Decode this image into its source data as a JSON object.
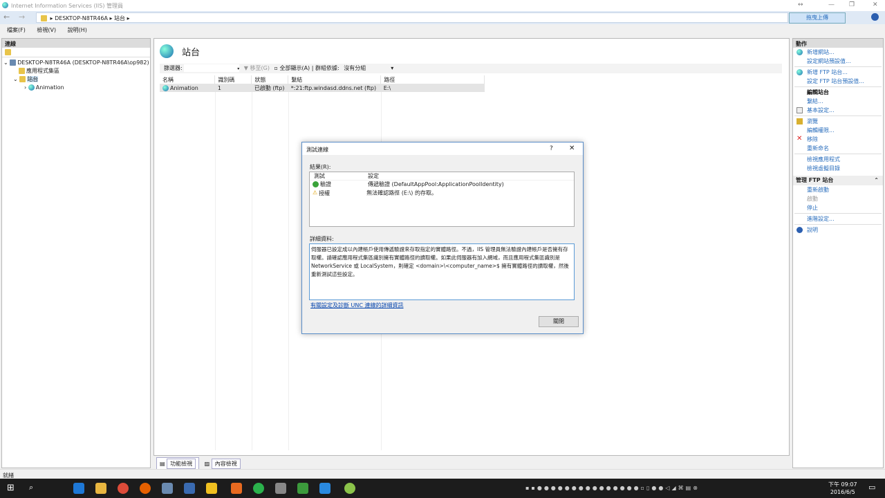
{
  "window": {
    "title": "Internet Information Services (IIS) 管理員"
  },
  "address": {
    "crumbs": [
      "DESKTOP-N8TR46A",
      "站台"
    ],
    "upload_button": "拖曳上傳"
  },
  "menu": [
    "檔案(F)",
    "檢視(V)",
    "說明(H)"
  ],
  "connections": {
    "title": "連線",
    "tree": [
      "DESKTOP-N8TR46A (DESKTOP-N8TR46A\\op982)",
      "應用程式集區",
      "站台",
      "Animation"
    ]
  },
  "center": {
    "title": "站台",
    "filter_label": "篩選器:",
    "go_label": "移至(G)",
    "show_all": "全部顯示(A)",
    "group_label": "群組依據:",
    "group_value": "沒有分組",
    "columns": [
      "名稱",
      "識別碼",
      "狀態",
      "繫結",
      "路徑"
    ],
    "rows": [
      [
        "Animation",
        "1",
        "已啟動 (ftp)",
        "*:21:ftp.windasd.ddns.net (ftp)",
        "E:\\"
      ]
    ],
    "tabs": [
      "功能檢視",
      "內容檢視"
    ]
  },
  "actions": {
    "title": "動作",
    "items": [
      {
        "label": "新增網站...",
        "icon": "globe"
      },
      {
        "label": "設定網站預設值..."
      },
      {
        "sep": true
      },
      {
        "label": "新增 FTP 站台...",
        "icon": "globe"
      },
      {
        "label": "設定 FTP 站台預設值..."
      },
      {
        "sep": true
      },
      {
        "label": "編輯站台",
        "header": true
      },
      {
        "label": "繫結..."
      },
      {
        "label": "基本設定...",
        "icon": "doc"
      },
      {
        "sep": true
      },
      {
        "label": "瀏覽",
        "icon": "explore"
      },
      {
        "label": "編輯權限..."
      },
      {
        "label": "移除",
        "icon": "x"
      },
      {
        "label": "重新命名"
      },
      {
        "sep": true
      },
      {
        "label": "檢視應用程式"
      },
      {
        "label": "檢視虛擬目錄"
      }
    ],
    "manage_title": "管理 FTP 站台",
    "manage_items": [
      {
        "label": "重新啟動"
      },
      {
        "label": "啟動",
        "disabled": true
      },
      {
        "label": "停止"
      },
      {
        "sep": true
      },
      {
        "label": "進階設定..."
      },
      {
        "sep": true
      },
      {
        "label": "說明",
        "icon": "help"
      }
    ]
  },
  "dialog": {
    "title": "測試連線",
    "help": "?",
    "close_x": "✕",
    "results_label": "結果(R):",
    "columns": [
      "測試",
      "設定"
    ],
    "rows": [
      {
        "status": "ok",
        "test": "驗證",
        "setting": "傳遞驗證 (DefaultAppPool:ApplicationPoolIdentity)"
      },
      {
        "status": "warning",
        "test": "授權",
        "setting": "無法確認路徑 (E:\\) 的存取。"
      }
    ],
    "details_label": "詳細資料:",
    "details": "伺服器已設定成以內建帳戶使用傳遞驗證來存取指定的實體路徑。不過，IIS 管理員無法驗證內建帳戶是否擁有存取權。請確認應用程式集區識別擁有實體路徑的讀取權。如果此伺服器有加入網域，而且應用程式集區識別是 NetworkService 或 LocalSystem，則確定 <domain>\\<computer_name>$ 擁有實體路徑的讀取權，然後重新測試這些設定。",
    "link": "有關設定及診斷 UNC 連線的詳細資訊",
    "close_button": "關閉"
  },
  "status": "就緒",
  "clock": {
    "time": "下午 09:07",
    "date": "2016/6/5"
  }
}
